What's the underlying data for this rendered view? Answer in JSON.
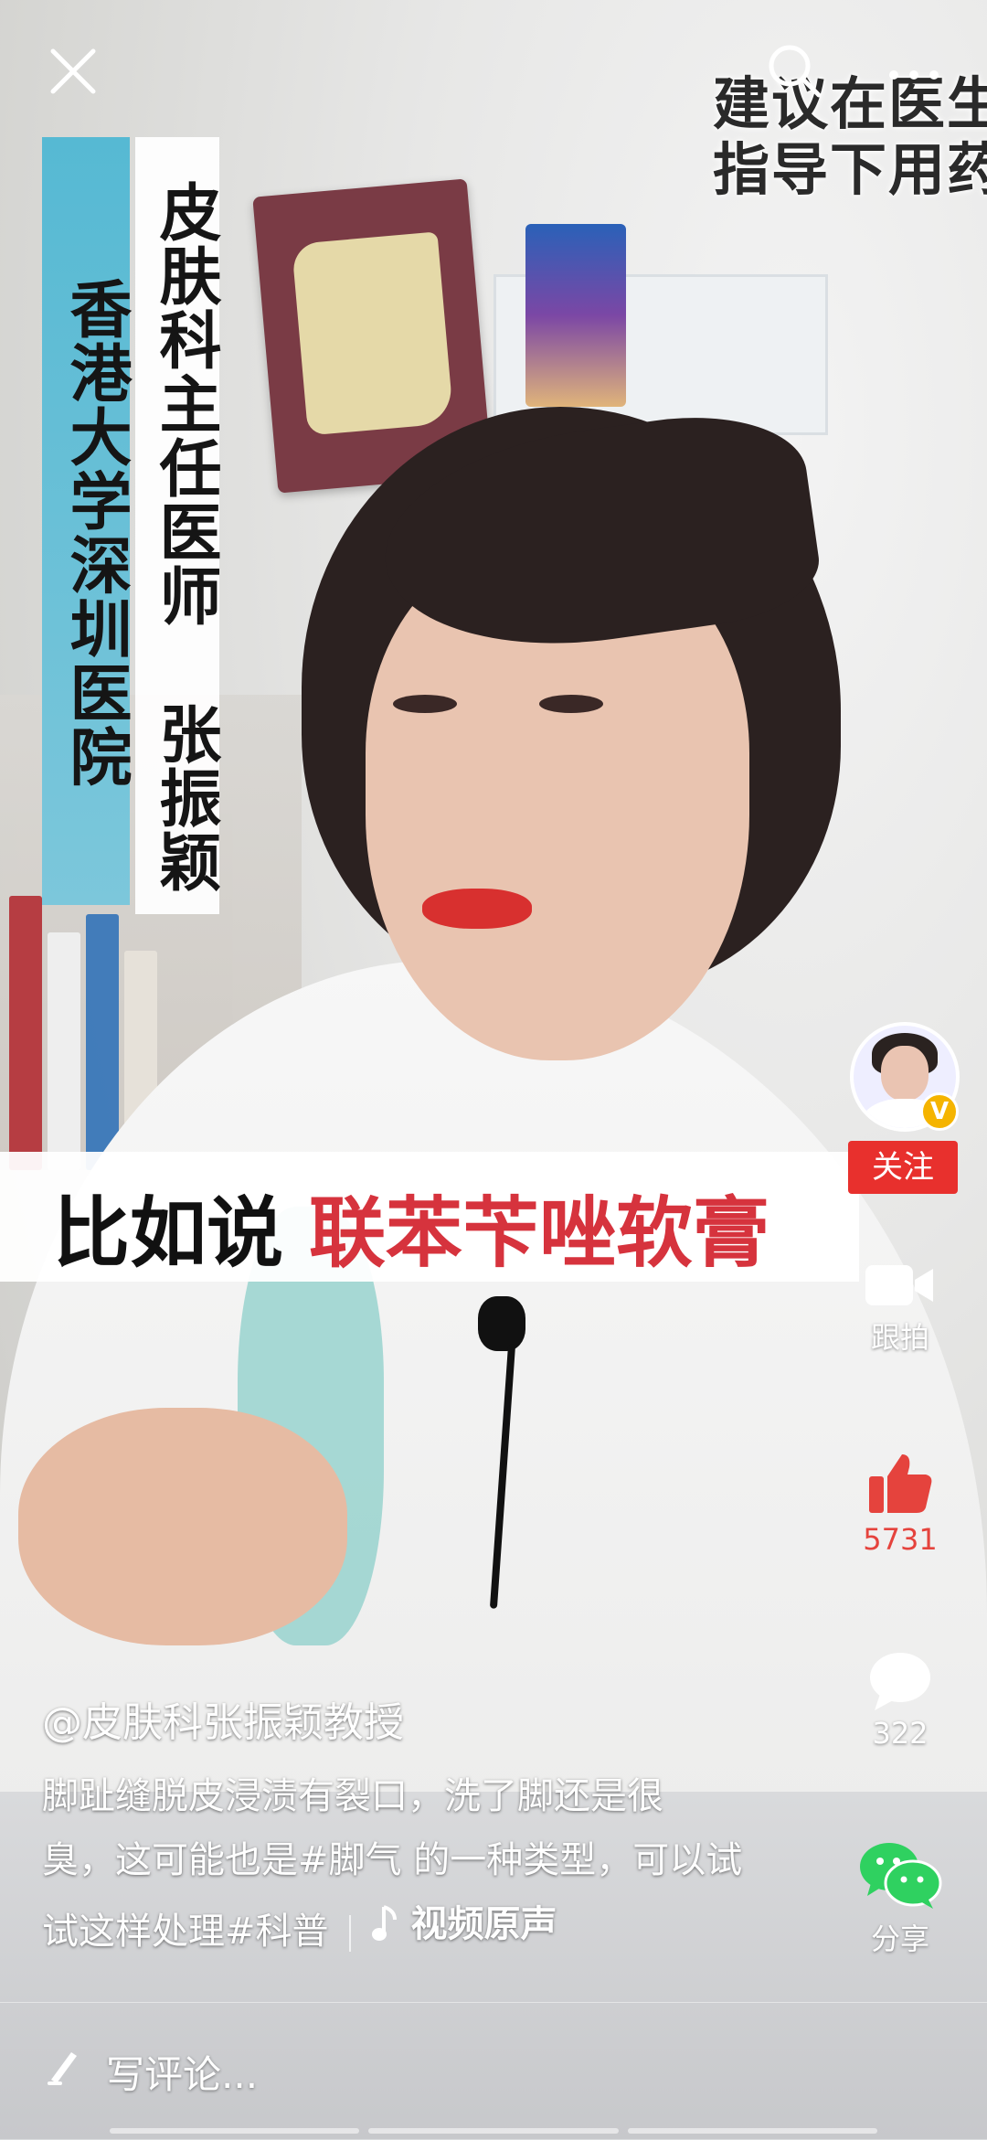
{
  "top_bar": {
    "close_icon": "close-icon",
    "search_icon": "search-icon",
    "more_icon": "more-dots-icon",
    "corner_note_line1": "建议在医生",
    "corner_note_line2": "指导下用药"
  },
  "video_overlay": {
    "hospital": "香港大学深圳医院",
    "doctor_title": "皮肤科主任医师 张振颖",
    "subtitle_part1": "比如说",
    "subtitle_part2": "联苯苄唑软膏"
  },
  "side_rail": {
    "verified_badge": "V",
    "follow_label": "关注",
    "duet_label": "跟拍",
    "likes_count": "5731",
    "comments_count": "322",
    "share_label": "分享",
    "colors": {
      "like": "#e5433d",
      "follow_bg": "#e8302d",
      "wechat": "#2fd160"
    }
  },
  "post": {
    "author": "@皮肤科张振颖教授",
    "desc_line1": "脚趾缝脱皮浸渍有裂口，洗了脚还是很",
    "desc_line2": "臭，这可能也是#脚气 的一种类型，可以试",
    "desc_line3_text": "试这样处理#科普",
    "music_label": "视频原声"
  },
  "comment_bar": {
    "placeholder": "写评论..."
  }
}
